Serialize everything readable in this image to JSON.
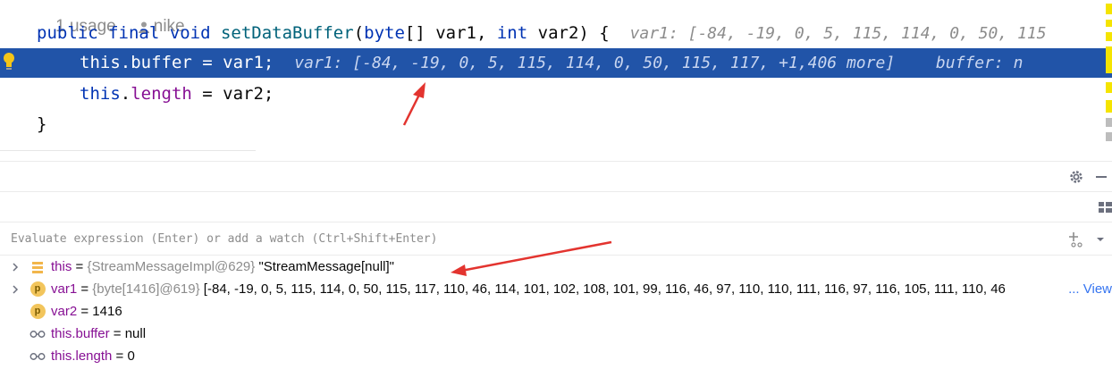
{
  "editor": {
    "usage_text": "1 usage",
    "author": "nike",
    "signature": {
      "kw_public": "public",
      "kw_final": "final",
      "kw_void": "void",
      "method": "setDataBuffer",
      "open": "(",
      "kw_byte": "byte",
      "arr_param": "[] var1, ",
      "kw_int": "int",
      "param2": " var2) {",
      "hint": "var1: [-84, -19, 0, 5, 115, 114, 0, 50, 115"
    },
    "line_buffer": {
      "kw_this": "this",
      "dot": ".",
      "field": "buffer",
      "rest": " = var1;",
      "hint": "var1: [-84, -19, 0, 5, 115, 114, 0, 50, 115, 117, +1,406 more]",
      "hint2": "buffer: n"
    },
    "line_length": {
      "kw_this": "this",
      "dot": ".",
      "field": "length",
      "rest": " = var2;"
    },
    "closing_brace": "}"
  },
  "debug": {
    "evaluate_placeholder": "Evaluate expression (Enter) or add a watch (Ctrl+Shift+Enter)",
    "variables": [
      {
        "name": "this",
        "eq": " = ",
        "type": "{StreamMessageImpl@629}",
        "value": " \"StreamMessage[null]\"",
        "icon": "field-stack-icon",
        "expandable": true
      },
      {
        "name": "var1",
        "eq": " = ",
        "type": "{byte[1416]@619}",
        "value": " [-84, -19, 0, 5, 115, 114, 0, 50, 115, 117, 110, 46, 114, 101, 102, 108, 101, 99, 116, 46, 97, 110, 110, 111, 116, 97, 116, 105, 111, 110, 46",
        "suffix": "... View",
        "icon": "parameter-icon",
        "expandable": true
      },
      {
        "name": "var2",
        "eq": " = ",
        "type": "",
        "value": "1416",
        "icon": "parameter-icon",
        "expandable": false
      },
      {
        "name": "this.buffer",
        "eq": " = ",
        "type": "",
        "value": "null",
        "icon": "watch-glasses-icon",
        "expandable": false
      },
      {
        "name": "this.length",
        "eq": " = ",
        "type": "",
        "value": "0",
        "icon": "watch-glasses-icon",
        "expandable": false
      }
    ]
  },
  "colors": {
    "highlight_line": "#2154a8",
    "keyword": "#0033b3",
    "method": "#00627a",
    "field": "#871094",
    "hint": "#8c8c8c",
    "annotation_arrow": "#e3342f"
  }
}
